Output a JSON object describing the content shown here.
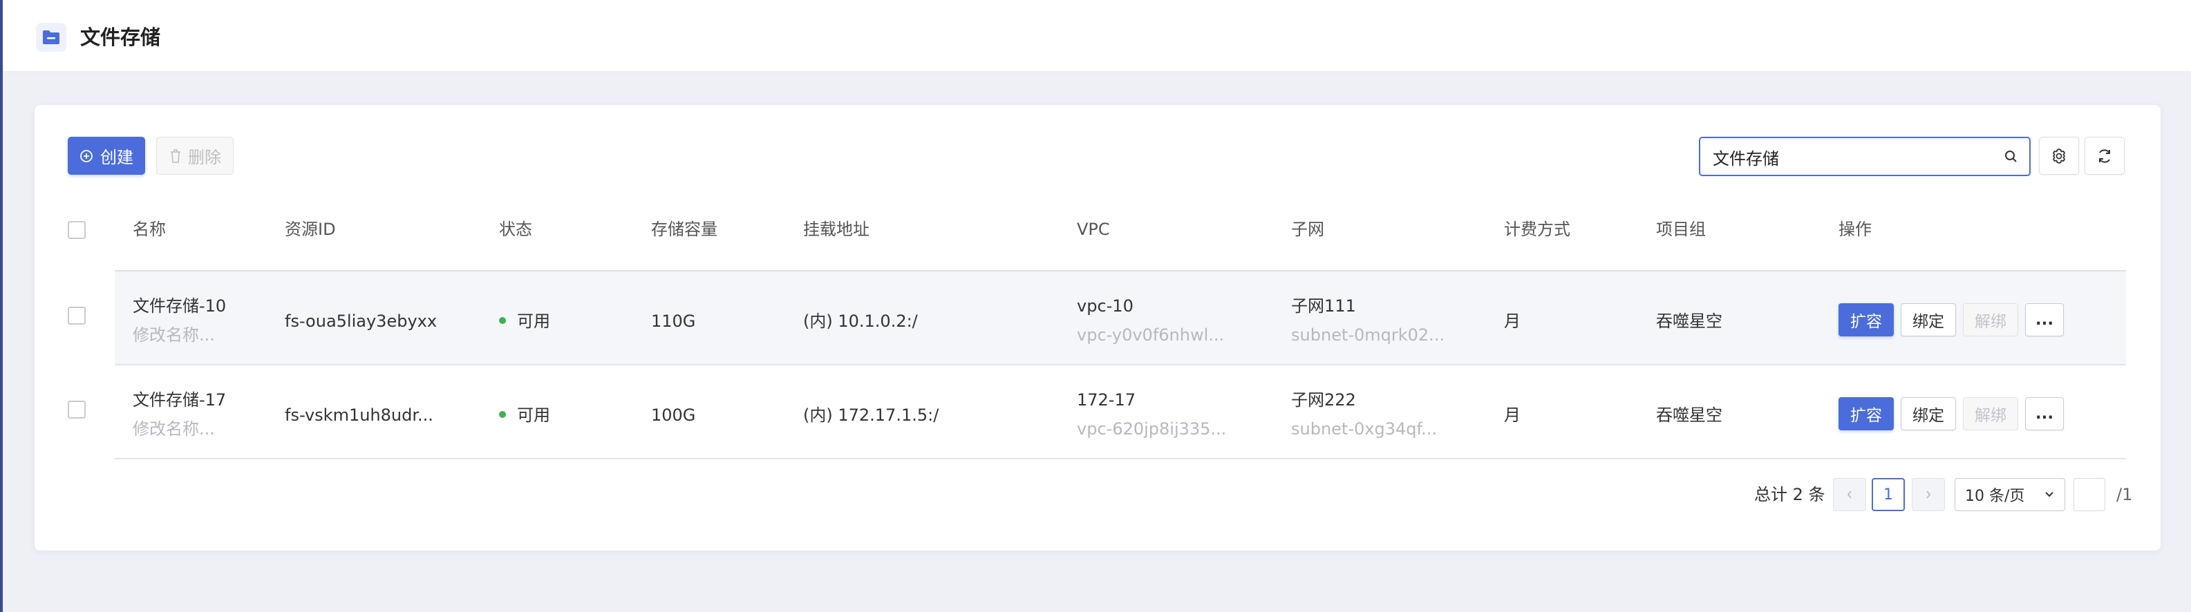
{
  "header": {
    "title": "文件存储",
    "icon": "folder-icon"
  },
  "toolbar": {
    "create_label": "创建",
    "delete_label": "删除",
    "search_value": "文件存储",
    "accent_color": "#4a6ddb"
  },
  "table": {
    "columns": [
      "名称",
      "资源ID",
      "状态",
      "存储容量",
      "挂载地址",
      "VPC",
      "子网",
      "计费方式",
      "项目组",
      "操作"
    ],
    "rows": [
      {
        "name": "文件存储-10",
        "remark": "修改名称...",
        "resource_id": "fs-oua5liay3ebyxx",
        "status": "可用",
        "capacity": "110G",
        "mount": "(内) 10.1.0.2:/",
        "vpc_name": "vpc-10",
        "vpc_id": "vpc-y0v0f6nhwl...",
        "subnet_name": "子网111",
        "subnet_id": "subnet-0mqrk02...",
        "billing": "月",
        "project": "吞噬星空",
        "actions": {
          "expand": "扩容",
          "bind": "绑定",
          "unbind": "解绑",
          "more": "..."
        }
      },
      {
        "name": "文件存储-17",
        "remark": "修改名称...",
        "resource_id": "fs-vskm1uh8udr...",
        "status": "可用",
        "capacity": "100G",
        "mount": "(内) 172.17.1.5:/",
        "vpc_name": "172-17",
        "vpc_id": "vpc-620jp8ij335...",
        "subnet_name": "子网222",
        "subnet_id": "subnet-0xg34qf...",
        "billing": "月",
        "project": "吞噬星空",
        "actions": {
          "expand": "扩容",
          "bind": "绑定",
          "unbind": "解绑",
          "more": "..."
        }
      }
    ]
  },
  "pagination": {
    "total": "总计 2 条",
    "current_page": "1",
    "page_size": "10 条/页",
    "page_of": "/1"
  }
}
